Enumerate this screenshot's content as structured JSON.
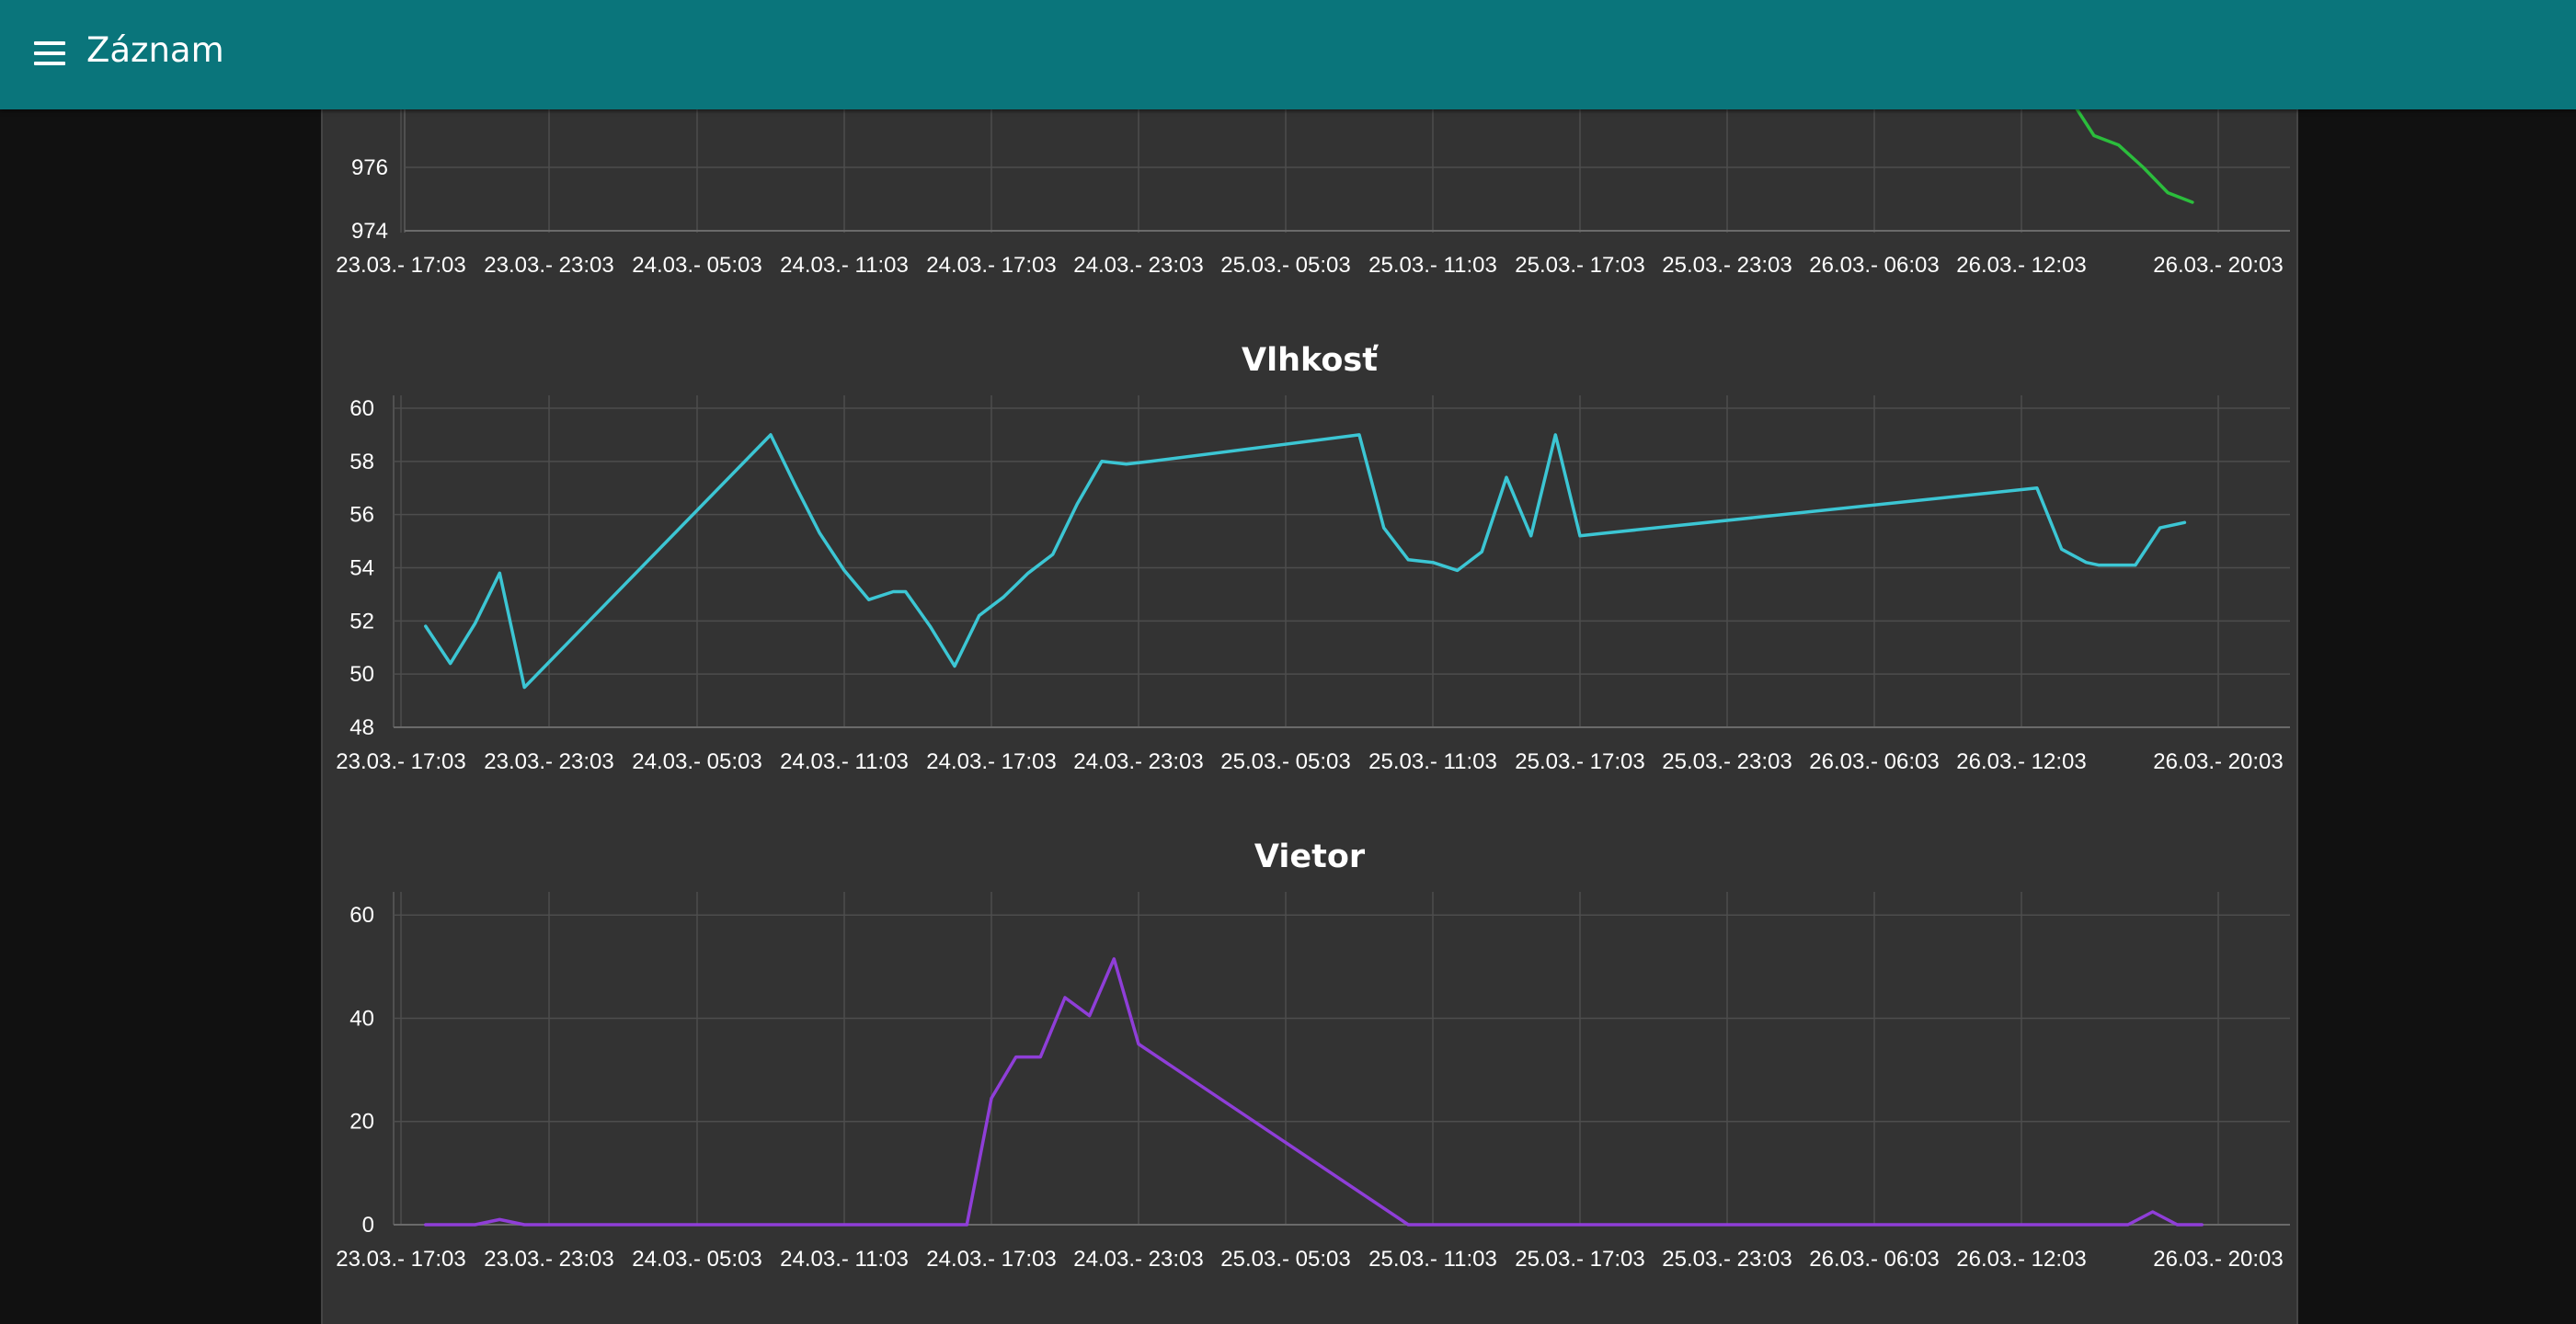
{
  "app": {
    "title": "Záznam"
  },
  "icons": {
    "menu": "hamburger-menu-icon"
  },
  "colors": {
    "app_bar": "#0a757b",
    "panel": "#333333",
    "page_background": "#111111",
    "pressure_line": "#2bbd3c",
    "humidity_line": "#3cc6d4",
    "wind_line": "#8f3ed8"
  },
  "chart_data": [
    {
      "type": "line",
      "title": "",
      "x_tick_labels": [
        "23.03.- 17:03",
        "23.03.- 23:03",
        "24.03.- 05:03",
        "24.03.- 11:03",
        "24.03.- 17:03",
        "24.03.- 23:03",
        "25.03.- 05:03",
        "25.03.- 11:03",
        "25.03.- 17:03",
        "25.03.- 23:03",
        "26.03.- 06:03",
        "26.03.- 12:03",
        "26.03.- 20:03"
      ],
      "y_tick_labels": [
        "974",
        "976"
      ],
      "y_ticks": [
        974,
        976
      ],
      "ylim": [
        974,
        978
      ],
      "grid": true,
      "series": [
        {
          "color": "#2bbd3c",
          "x": [
            "26.03. 14:00",
            "26.03. 15:00",
            "26.03. 16:00",
            "26.03. 17:00",
            "26.03. 18:00",
            "26.03. 19:00"
          ],
          "values": [
            978.2,
            977.0,
            976.7,
            976.0,
            975.2,
            974.9
          ]
        }
      ]
    },
    {
      "type": "line",
      "title": "Vlhkosť",
      "x_tick_labels": [
        "23.03.- 17:03",
        "23.03.- 23:03",
        "24.03.- 05:03",
        "24.03.- 11:03",
        "24.03.- 17:03",
        "24.03.- 23:03",
        "25.03.- 05:03",
        "25.03.- 11:03",
        "25.03.- 17:03",
        "25.03.- 23:03",
        "26.03.- 06:03",
        "26.03.- 12:03",
        "26.03.- 20:03"
      ],
      "y_tick_labels": [
        "48",
        "50",
        "52",
        "54",
        "56",
        "58",
        "60"
      ],
      "y_ticks": [
        48,
        50,
        52,
        54,
        56,
        58,
        60
      ],
      "ylim": [
        48,
        60
      ],
      "grid": true,
      "series": [
        {
          "color": "#3cc6d4",
          "x": [
            "23.03. 18:03",
            "23.03. 19:03",
            "23.03. 20:03",
            "23.03. 21:03",
            "23.03. 22:03",
            "24.03. 08:03",
            "24.03. 09:03",
            "24.03. 10:03",
            "24.03. 11:03",
            "24.03. 12:03",
            "24.03. 13:03",
            "24.03. 13:33",
            "24.03. 14:33",
            "24.03. 15:33",
            "24.03. 16:33",
            "24.03. 17:33",
            "24.03. 18:33",
            "24.03. 19:33",
            "24.03. 20:33",
            "24.03. 21:33",
            "24.03. 22:33",
            "24.03. 23:33",
            "25.03. 08:03",
            "25.03. 09:03",
            "25.03. 10:03",
            "25.03. 11:03",
            "25.03. 12:03",
            "25.03. 13:03",
            "25.03. 14:03",
            "25.03. 15:03",
            "25.03. 16:03",
            "25.03. 17:03",
            "25.03. 18:03",
            "26.03. 12:41",
            "26.03. 13:41",
            "26.03. 14:41",
            "26.03. 15:11",
            "26.03. 16:41",
            "26.03. 17:41",
            "26.03. 18:41"
          ],
          "values": [
            51.8,
            50.4,
            51.9,
            53.8,
            49.5,
            59.0,
            57.1,
            55.3,
            53.9,
            52.8,
            53.1,
            53.1,
            51.8,
            50.3,
            52.2,
            52.9,
            53.8,
            54.5,
            56.4,
            58.0,
            57.9,
            58.0,
            59.0,
            55.5,
            54.3,
            54.2,
            53.9,
            54.6,
            57.4,
            55.2,
            59.0,
            55.2,
            55.3,
            57.0,
            54.7,
            54.2,
            54.1,
            54.1,
            55.5,
            55.7
          ]
        }
      ]
    },
    {
      "type": "line",
      "title": "Vietor",
      "x_tick_labels": [
        "23.03.- 17:03",
        "23.03.- 23:03",
        "24.03.- 05:03",
        "24.03.- 11:03",
        "24.03.- 17:03",
        "24.03.- 23:03",
        "25.03.- 05:03",
        "25.03.- 11:03",
        "25.03.- 17:03",
        "25.03.- 23:03",
        "26.03.- 06:03",
        "26.03.- 12:03",
        "26.03.- 20:03"
      ],
      "y_tick_labels": [
        "0",
        "20",
        "40",
        "60"
      ],
      "y_ticks": [
        0,
        20,
        40,
        60
      ],
      "ylim": [
        0,
        62
      ],
      "grid": true,
      "series": [
        {
          "color": "#8f3ed8",
          "x": [
            "23.03. 18:03",
            "23.03. 19:03",
            "23.03. 20:03",
            "23.03. 21:03",
            "23.03. 22:03",
            "24.03. 12:03",
            "24.03. 16:03",
            "24.03. 17:03",
            "24.03. 18:03",
            "24.03. 19:03",
            "24.03. 20:03",
            "24.03. 21:03",
            "24.03. 22:03",
            "24.03. 23:03",
            "25.03. 10:03",
            "26.03. 16:23",
            "26.03. 17:23",
            "26.03. 18:23",
            "26.03. 19:23"
          ],
          "values": [
            0,
            0,
            0,
            1,
            0,
            0,
            0,
            24.5,
            32.5,
            32.5,
            44,
            40.5,
            51.5,
            35,
            0,
            0,
            2.5,
            0,
            0
          ]
        }
      ]
    }
  ]
}
